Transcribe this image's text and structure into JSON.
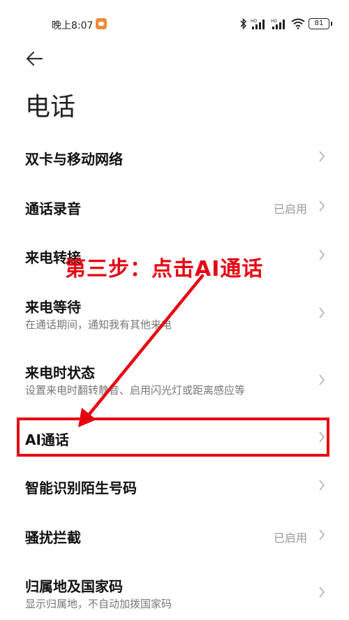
{
  "status_bar": {
    "time": "晚上8:07",
    "battery": "81",
    "icons": [
      "app-notification-icon",
      "bluetooth-icon",
      "hd-signal-icon",
      "hd-signal-icon",
      "wifi-icon",
      "battery-icon"
    ]
  },
  "header": {
    "back_icon": "back-arrow-icon",
    "title": "电话"
  },
  "settings": [
    {
      "label": "双卡与移动网络",
      "sub": "",
      "status": ""
    },
    {
      "label": "通话录音",
      "sub": "",
      "status": "已启用"
    },
    {
      "label": "来电转接",
      "sub": "",
      "status": ""
    },
    {
      "label": "来电等待",
      "sub": "在通话期间，通知我有其他来电",
      "status": ""
    },
    {
      "label": "来电时状态",
      "sub": "设置来电时翻转静音、启用闪光灯或距离感应等",
      "status": ""
    },
    {
      "label": "AI通话",
      "sub": "",
      "status": ""
    },
    {
      "label": "智能识别陌生号码",
      "sub": "",
      "status": ""
    },
    {
      "label": "骚扰拦截",
      "sub": "",
      "status": "已启用"
    },
    {
      "label": "归属地及国家码",
      "sub": "显示归属地，不自动加拨国家码",
      "status": ""
    }
  ],
  "annotation": {
    "text": "第三步：点击AI通话",
    "color": "#e60012"
  },
  "colors": {
    "highlight": "#e60012",
    "label": "#111111",
    "sub": "#777777",
    "status": "#999999",
    "chevron": "#b0b0b0"
  }
}
